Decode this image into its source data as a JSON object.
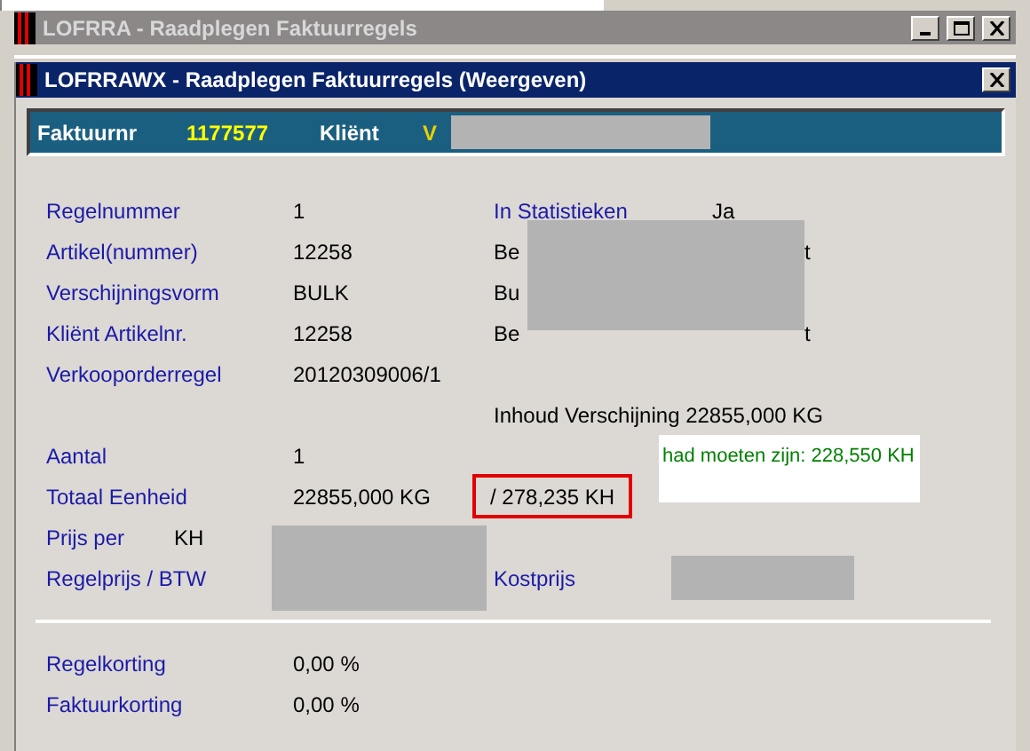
{
  "outer_window": {
    "title": "LOFRRA - Raadplegen Faktuurregels"
  },
  "dialog": {
    "title": "LOFRRAWX - Raadplegen Faktuurregels (Weergeven)"
  },
  "header": {
    "invoice_label": "Faktuurnr",
    "invoice_value": "1177577",
    "client_label": "Kliënt",
    "client_value_visible": "V"
  },
  "fields": [
    {
      "label": "Regelnummer",
      "value": "1",
      "right_label": "In Statistieken",
      "right_value": "Ja"
    },
    {
      "label": "Artikel(nummer)",
      "value": "12258",
      "right_start": "Be",
      "right_end": "t"
    },
    {
      "label": "Verschijningsvorm",
      "value": "BULK",
      "right_start": "Bu"
    },
    {
      "label": "Kliënt Artikelnr.",
      "value": "12258",
      "right_start": "Be",
      "right_end": "t"
    },
    {
      "label": "Verkooporderregel",
      "value": "20120309006/1"
    }
  ],
  "content_note": "Inhoud Verschijning 22855,000 KG",
  "quantity": {
    "label": "Aantal",
    "value": "1"
  },
  "total_unit": {
    "label": "Totaal Eenheid",
    "value": "22855,000 KG",
    "highlighted_value": "/ 278,235 KH"
  },
  "comment": "had moeten zijn: 228,550 KH",
  "price_per": {
    "label": "Prijs per",
    "unit": "KH"
  },
  "line_price": {
    "label": "Regelprijs / BTW",
    "cost_label": "Kostprijs"
  },
  "discounts": [
    {
      "label": "Regelkorting",
      "value": "0,00 %"
    },
    {
      "label": "Faktuurkorting",
      "value": "0,00 %"
    }
  ]
}
